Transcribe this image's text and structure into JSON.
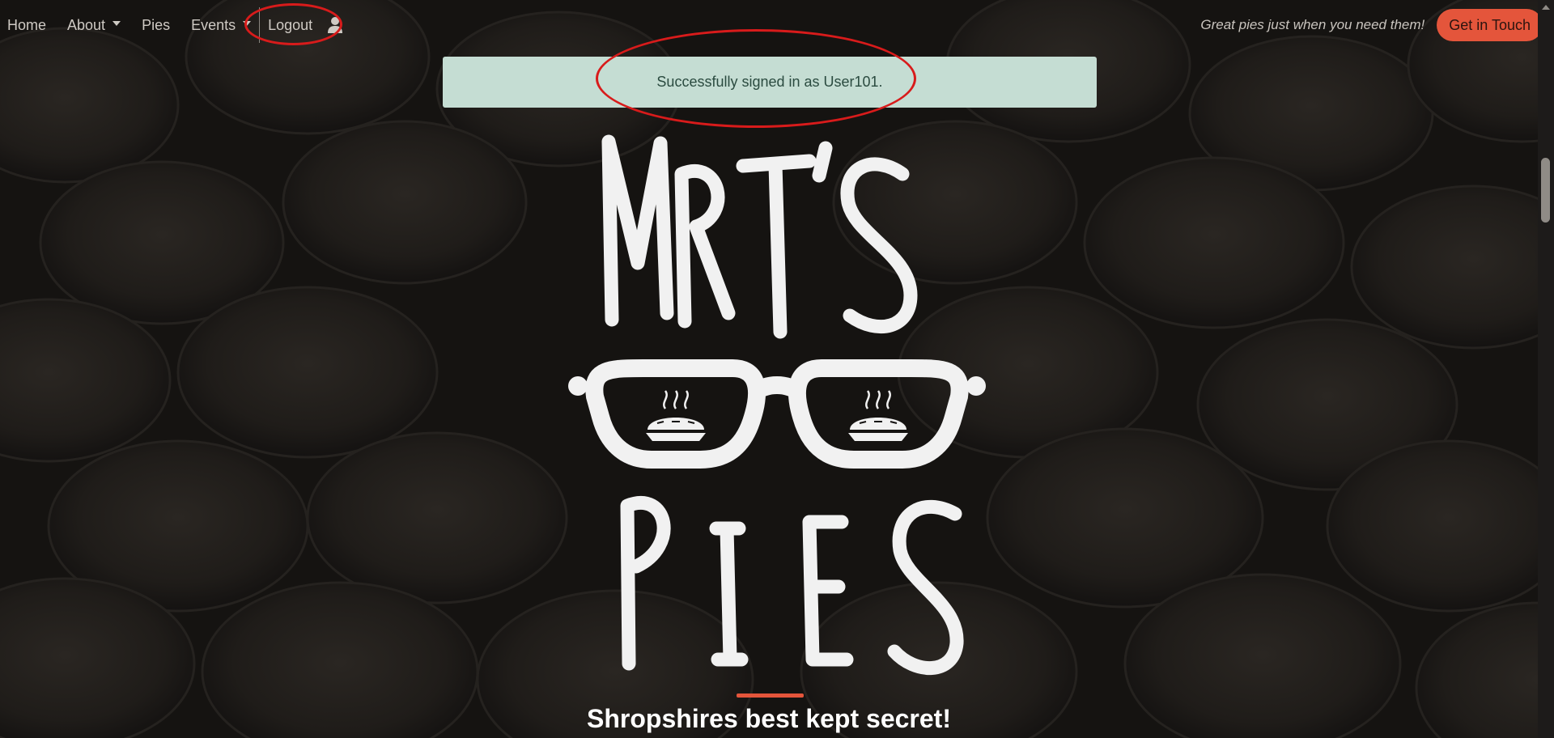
{
  "nav": {
    "home": "Home",
    "about": "About",
    "pies": "Pies",
    "events": "Events",
    "logout": "Logout",
    "tagline": "Great pies just when you need them!",
    "cta": "Get in Touch"
  },
  "alert": {
    "message": "Successfully signed in as User101."
  },
  "hero": {
    "logo_lines": [
      "MR T'S",
      "PIES"
    ],
    "tagline": "Shropshires best kept secret!"
  },
  "icons": {
    "user": "user-icon",
    "dropdown": "caret-down-icon",
    "steam_pie": "steaming-pie-icon"
  },
  "colors": {
    "accent": "#e4553b",
    "alert_bg": "#c5ddd3",
    "alert_text": "#2b4b40",
    "annotation": "#d81b1b",
    "nav_text": "#cfcac4",
    "background": "#141211"
  }
}
